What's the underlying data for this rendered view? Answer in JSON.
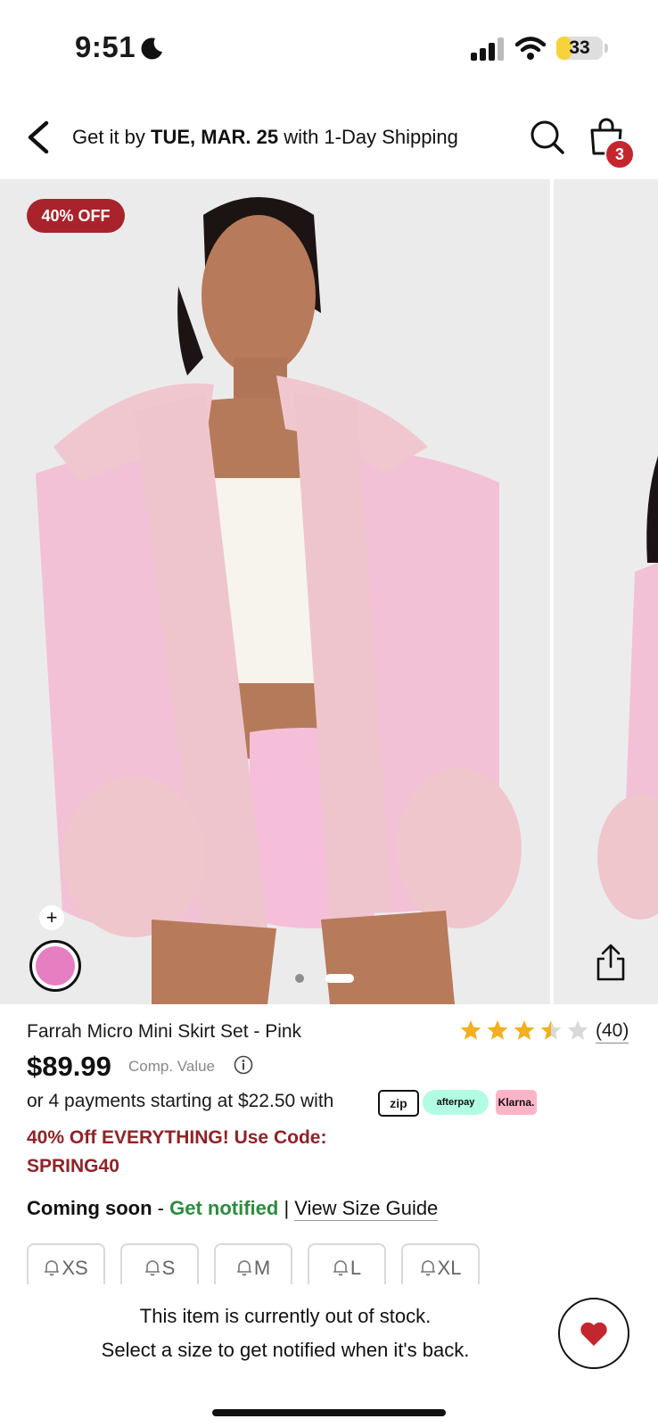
{
  "status_bar": {
    "time": "9:51",
    "battery": "33",
    "battery_level": 0.33
  },
  "header": {
    "shipping_prefix": "Get it by ",
    "shipping_date": "TUE, MAR. 25",
    "shipping_suffix": " with 1-Day Shipping",
    "cart_count": "3"
  },
  "gallery": {
    "badge": "40% OFF",
    "swatch_add": "+",
    "swatch_color": "#e67fc1",
    "page_index": 2,
    "page_count": 3
  },
  "product": {
    "name": "Farrah Micro Mini Skirt Set - Pink",
    "rating": 3.5,
    "rating_count": "(40)",
    "price": "$89.99",
    "comp_value": "Comp. Value",
    "payments_text": "or 4 payments starting at $22.50 with",
    "zip_label": "zip",
    "afterpay_label": "afterpay",
    "klarna_label": "Klarna.",
    "promo_line1": "40% Off EVERYTHING! Use Code:",
    "promo_line2": "SPRING40",
    "coming_soon": "Coming soon",
    "dash": " - ",
    "get_notified": "Get notified",
    "separator": " | ",
    "size_guide": "View Size Guide",
    "sizes": [
      "XS",
      "S",
      "M",
      "L",
      "XL"
    ]
  },
  "bottom": {
    "oos_line1": "This item is currently out of stock.",
    "oos_line2": "Select a size to get notified when it's back."
  },
  "colors": {
    "accent_red": "#a8232b",
    "promo_red": "#8f2328",
    "notify_green": "#2e8b3e",
    "heart": "#c4262e"
  }
}
